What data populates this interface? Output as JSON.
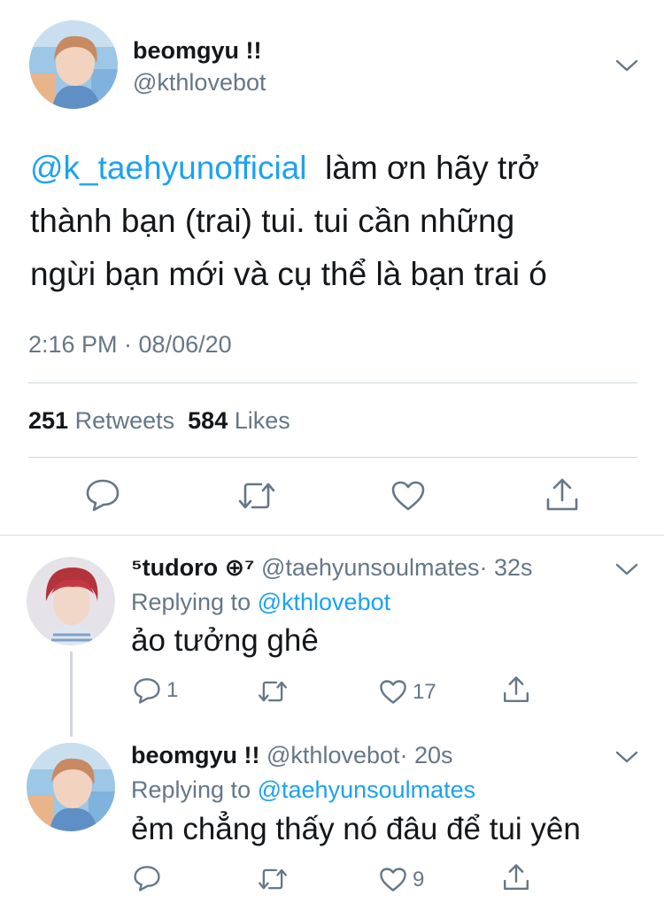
{
  "main_tweet": {
    "author_name": "beomgyu !!",
    "author_handle": "@kthlovebot",
    "mention": "@k_taehyunofficial",
    "text_line1": "làm ơn hãy trở",
    "text_line2": "thành bạn (trai) tui. tui cần những",
    "text_line3": "ngừi bạn mới và cụ thể là bạn trai ó",
    "timestamp": "2:16 PM · 08/06/20",
    "retweets_count": "251",
    "retweets_label": "Retweets",
    "likes_count": "584",
    "likes_label": "Likes"
  },
  "replies": [
    {
      "author_name": "⁵tudoro ⊕⁷",
      "author_handle": "@taehyunsoulmates",
      "time": "· 32s",
      "replying_prefix": "Replying to",
      "replying_handle": "@kthlovebot",
      "text": "ảo tưởng ghê",
      "reply_count": "1",
      "retweet_count": "",
      "like_count": "17"
    },
    {
      "author_name": "beomgyu !!",
      "author_handle": "@kthlovebot",
      "time": "· 20s",
      "replying_prefix": "Replying to",
      "replying_handle": "@taehyunsoulmates",
      "text": "ẻm chẳng thấy nó đâu để tui yên",
      "reply_count": "",
      "retweet_count": "",
      "like_count": "9"
    }
  ],
  "icons": {
    "reply": "reply-icon",
    "retweet": "retweet-icon",
    "like": "heart-icon",
    "share": "share-icon",
    "more": "chevron-down-icon"
  },
  "colors": {
    "link_blue": "#1da1f2",
    "secondary_gray": "#657786",
    "divider": "#ccd6dd"
  }
}
